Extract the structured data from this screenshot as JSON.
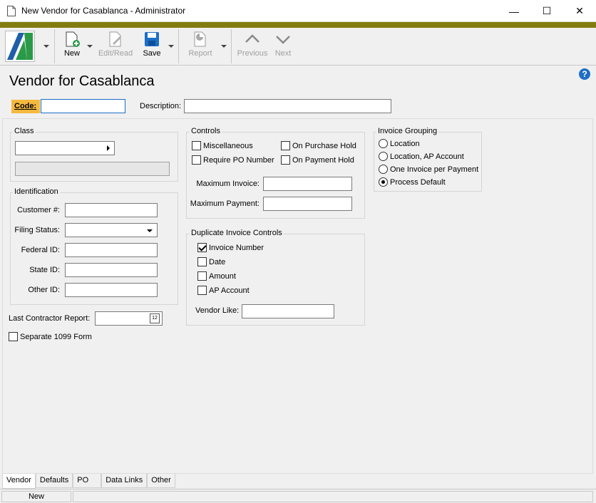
{
  "window": {
    "title": "New Vendor for Casablanca - Administrator",
    "minimize": "—",
    "maximize": "☐",
    "close": "✕"
  },
  "toolbar": {
    "new_label": "New",
    "edit_read_label": "Edit/Read",
    "save_label": "Save",
    "report_label": "Report",
    "previous_label": "Previous",
    "next_label": "Next"
  },
  "header": {
    "title": "Vendor for Casablanca",
    "code_label": "Code:",
    "code_value": "",
    "description_label": "Description:",
    "description_value": "",
    "help": "?"
  },
  "class": {
    "label": "Class",
    "value": "",
    "readonly_value": ""
  },
  "identification": {
    "label": "Identification",
    "customer_label": "Customer #:",
    "filing_status_label": "Filing Status:",
    "federal_id_label": "Federal ID:",
    "state_id_label": "State ID:",
    "other_id_label": "Other ID:",
    "customer_value": "",
    "filing_status_value": "",
    "federal_id_value": "",
    "state_id_value": "",
    "other_id_value": ""
  },
  "misc": {
    "last_contractor_label": "Last Contractor Report:",
    "last_contractor_value": "",
    "calendar_glyph": "12",
    "separate_1099_label": "Separate 1099 Form",
    "separate_1099_checked": false
  },
  "controls": {
    "label": "Controls",
    "miscellaneous": "Miscellaneous",
    "on_purchase_hold": "On Purchase Hold",
    "require_po": "Require PO Number",
    "on_payment_hold": "On Payment Hold",
    "max_invoice_label": "Maximum Invoice:",
    "max_payment_label": "Maximum Payment:",
    "max_invoice_value": "",
    "max_payment_value": ""
  },
  "duplicate": {
    "label": "Duplicate Invoice Controls",
    "invoice_number": "Invoice Number",
    "invoice_number_checked": true,
    "date": "Date",
    "amount": "Amount",
    "ap_account": "AP Account",
    "vendor_like_label": "Vendor Like:",
    "vendor_like_value": ""
  },
  "invoice_grouping": {
    "label": "Invoice Grouping",
    "options": [
      "Location",
      "Location, AP Account",
      "One Invoice per Payment",
      "Process Default"
    ],
    "selected": "Process Default"
  },
  "tabs": [
    "Vendor",
    "Defaults",
    "PO",
    "Data Links",
    "Other"
  ],
  "active_tab": "Vendor",
  "status": {
    "mode": "New"
  },
  "colors": {
    "accent_bar": "#817c0f",
    "code_label_bg": "#f5b940",
    "help_blue": "#1f6fc5",
    "save_blue": "#1a6ec8"
  }
}
